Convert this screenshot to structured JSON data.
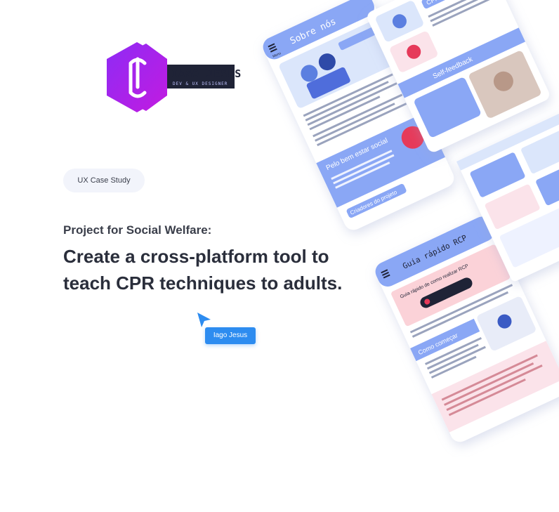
{
  "logo": {
    "name": "IAGO JESUS",
    "tagline": "DEV & UX DESIGNER",
    "icon": "hexagon-logo-icon",
    "colors": {
      "hex_from": "#8e2bf5",
      "hex_to": "#c21be0",
      "plate": "#1f2336"
    }
  },
  "badge": {
    "label": "UX Case Study"
  },
  "hero": {
    "subtitle": "Project for Social Welfare:",
    "headline_line1": " Create a cross-platform tool to",
    "headline_line2": "teach CPR techniques to adults."
  },
  "cursor": {
    "icon": "pointer-cursor-icon",
    "label": "Iago Jesus",
    "color": "#2d8cf0"
  },
  "mockups": {
    "accent": "#8aa7f5",
    "menu": "Menu",
    "sobre_nos": "Sobre nós",
    "pelo_bem_estar_social": "Pelo bem estar social",
    "criadores_do_projeto": "Criadores do projeto",
    "guia_rapido_rcp": "Guia rápido RCP",
    "guia_rapido_sub": "Guia rápido de como realizar RCP",
    "como_comecar": "Como começar",
    "cpr_in_children": "CPR in children",
    "self_feedback": "Self-feedback"
  }
}
